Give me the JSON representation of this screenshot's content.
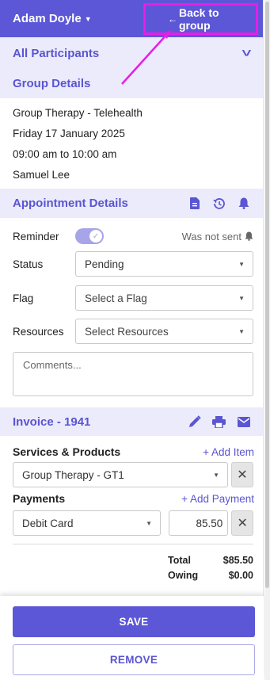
{
  "header": {
    "user_name": "Adam Doyle",
    "back_label": "Back to group"
  },
  "participants": {
    "title": "All Participants"
  },
  "group_details": {
    "title": "Group Details",
    "lines": [
      "Group Therapy - Telehealth",
      "Friday 17 January 2025",
      "09:00 am to 10:00 am",
      "Samuel Lee"
    ]
  },
  "appointment": {
    "title": "Appointment Details",
    "icons": [
      "document-icon",
      "history-icon",
      "bell-icon"
    ],
    "reminder_label": "Reminder",
    "reminder_on": true,
    "not_sent_label": "Was not sent",
    "status_label": "Status",
    "status_value": "Pending",
    "flag_label": "Flag",
    "flag_placeholder": "Select a Flag",
    "resources_label": "Resources",
    "resources_placeholder": "Select Resources",
    "comments_placeholder": "Comments..."
  },
  "invoice": {
    "title": "Invoice - 1941",
    "icons": [
      "pencil-icon",
      "printer-icon",
      "envelope-icon"
    ],
    "services_label": "Services & Products",
    "add_item": "+ Add Item",
    "service_value": "Group Therapy - GT1",
    "payments_label": "Payments",
    "add_payment": "+ Add Payment",
    "payment_method": "Debit Card",
    "payment_amount": "85.50",
    "total_label": "Total",
    "total_value": "$85.50",
    "owing_label": "Owing",
    "owing_value": "$0.00"
  },
  "footer": {
    "save_label": "SAVE",
    "remove_label": "REMOVE"
  },
  "colors": {
    "primary": "#5c57d6",
    "band": "#ecebfb",
    "highlight": "#e61ee6"
  }
}
